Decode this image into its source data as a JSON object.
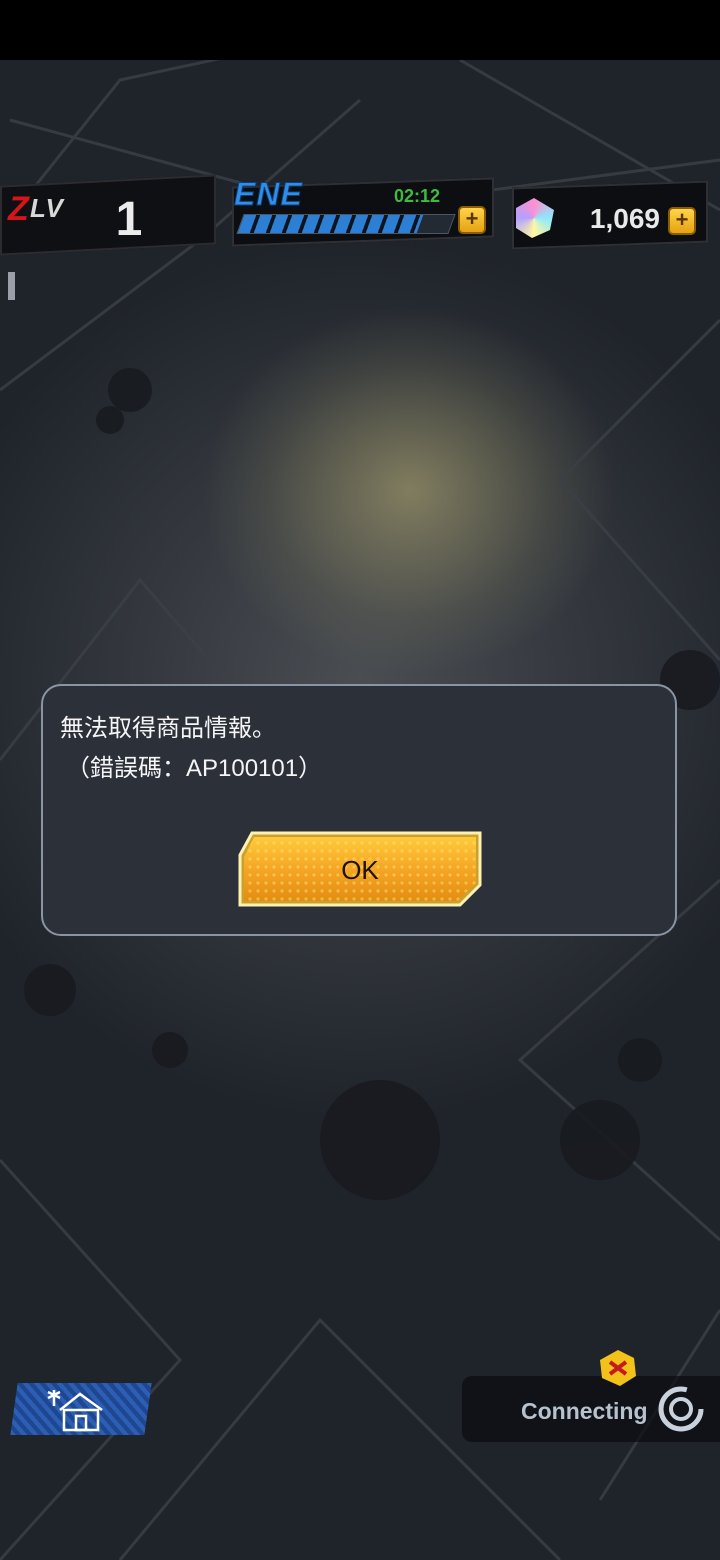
{
  "hud": {
    "level_label": "LV",
    "level_value": "1",
    "energy_label": "ENE",
    "energy_timer": "02:12",
    "energy_fill_fraction": 0.85,
    "gem_count": "1,069",
    "plus_glyph": "+"
  },
  "dialog": {
    "message": "無法取得商品情報。",
    "error_code": "（錯誤碼：AP100101）",
    "ok_label": "OK"
  },
  "bottom": {
    "connecting_label": "Connecting"
  },
  "icons": {
    "level": "level-badge-icon",
    "energy_plus": "plus-icon",
    "gem": "gem-icon",
    "gem_plus": "plus-icon",
    "home": "home-icon",
    "spinner": "loading-spinner-icon",
    "badge": "notification-badge-icon"
  },
  "colors": {
    "accent_gold": "#f0a81f",
    "energy_blue": "#2d7fd6",
    "timer_green": "#3fbb3f",
    "level_red": "#d7141a",
    "dialog_bg": "#2b3039"
  }
}
